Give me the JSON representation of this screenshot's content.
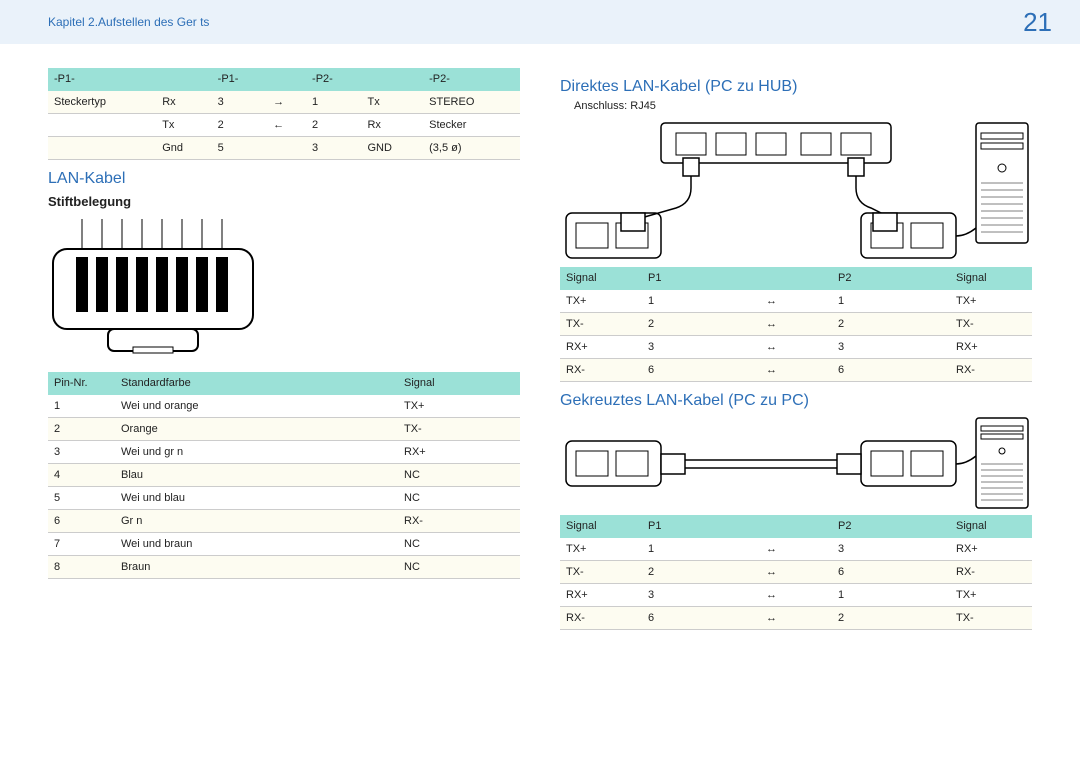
{
  "header": {
    "chapter": "Kapitel 2.Aufstellen des Ger ts",
    "page": "21"
  },
  "left": {
    "plugtable": {
      "head": [
        "-P1-",
        "",
        "-P1-",
        "",
        "-P2-",
        "",
        "-P2-"
      ],
      "rows": [
        [
          "Steckertyp",
          "Rx",
          "3",
          "→",
          "1",
          "Tx",
          "STEREO"
        ],
        [
          "",
          "Tx",
          "2",
          "←",
          "2",
          "Rx",
          "Stecker"
        ],
        [
          "",
          "Gnd",
          "5",
          "",
          "3",
          "GND",
          "(3,5 ø)"
        ]
      ]
    },
    "section": "LAN-Kabel",
    "subsection": "Stiftbelegung",
    "pintable": {
      "head": [
        "Pin-Nr.",
        "Standardfarbe",
        "Signal"
      ],
      "rows": [
        [
          "1",
          "Wei  und orange",
          "TX+"
        ],
        [
          "2",
          "Orange",
          "TX-"
        ],
        [
          "3",
          "Wei  und gr n",
          "RX+"
        ],
        [
          "4",
          "Blau",
          "NC"
        ],
        [
          "5",
          "Wei  und blau",
          "NC"
        ],
        [
          "6",
          "Gr n",
          "RX-"
        ],
        [
          "7",
          "Wei  und braun",
          "NC"
        ],
        [
          "8",
          "Braun",
          "NC"
        ]
      ]
    }
  },
  "right": {
    "direct": {
      "title": "Direktes LAN-Kabel (PC zu HUB)",
      "note": "Anschluss: RJ45",
      "table": {
        "head": [
          "Signal",
          "P1",
          "",
          "P2",
          "Signal"
        ],
        "rows": [
          [
            "TX+",
            "1",
            "↔",
            "1",
            "TX+"
          ],
          [
            "TX-",
            "2",
            "↔",
            "2",
            "TX-"
          ],
          [
            "RX+",
            "3",
            "↔",
            "3",
            "RX+"
          ],
          [
            "RX-",
            "6",
            "↔",
            "6",
            "RX-"
          ]
        ]
      }
    },
    "cross": {
      "title": "Gekreuztes LAN-Kabel (PC zu PC)",
      "table": {
        "head": [
          "Signal",
          "P1",
          "",
          "P2",
          "Signal"
        ],
        "rows": [
          [
            "TX+",
            "1",
            "↔",
            "3",
            "RX+"
          ],
          [
            "TX-",
            "2",
            "↔",
            "6",
            "RX-"
          ],
          [
            "RX+",
            "3",
            "↔",
            "1",
            "TX+"
          ],
          [
            "RX-",
            "6",
            "↔",
            "2",
            "TX-"
          ]
        ]
      }
    }
  }
}
